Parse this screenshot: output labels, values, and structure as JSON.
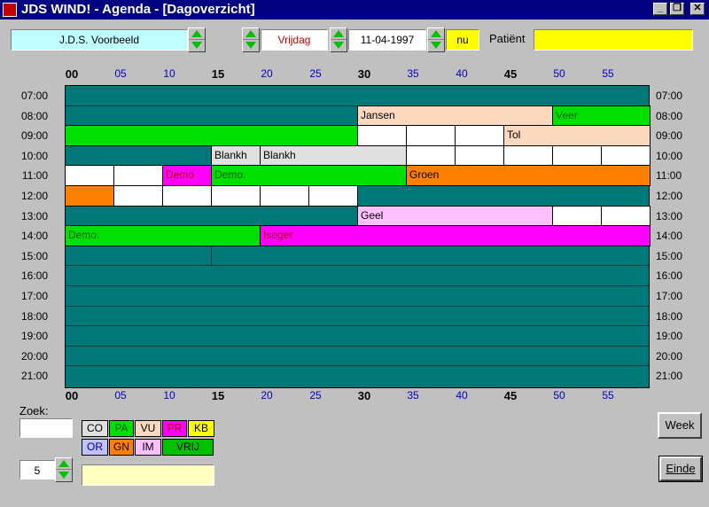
{
  "window": {
    "title": "JDS WIND! - Agenda - [Dagoverzicht]",
    "controls": {
      "minimize": "_",
      "restore": "❐",
      "close": "✕"
    }
  },
  "toolbar": {
    "practitioner": "J.D.S. Voorbeeld",
    "day": "Vrijdag",
    "date": "11-04-1997",
    "now_button": "nu",
    "patient_label": "Patiënt",
    "patient_value": ""
  },
  "grid": {
    "minutes": [
      "00",
      "05",
      "10",
      "15",
      "20",
      "25",
      "30",
      "35",
      "40",
      "45",
      "50",
      "55"
    ],
    "hours": [
      "07:00",
      "08:00",
      "09:00",
      "10:00",
      "11:00",
      "12:00",
      "13:00",
      "14:00",
      "15:00",
      "16:00",
      "17:00",
      "18:00",
      "19:00",
      "20:00",
      "21:00"
    ]
  },
  "colors": {
    "free_teal": "#007878",
    "green": "#00e000",
    "peach": "#fcd9be",
    "light_gray": "#e0e0e0",
    "magenta": "#ff00ff",
    "orange": "#ff8000",
    "pink": "#ffc0ff",
    "white": "#ffffff"
  },
  "appointments": [
    {
      "hour": 1,
      "start": 6,
      "len": 4,
      "label": "Jansen",
      "color": "#fcd9be",
      "text_color": "#000000"
    },
    {
      "hour": 1,
      "start": 10,
      "len": 2,
      "label": "Veer",
      "color": "#00e000",
      "text_color": "#006000"
    },
    {
      "hour": 2,
      "start": 0,
      "len": 6,
      "label": "",
      "color": "#00e000",
      "text_color": "#000000"
    },
    {
      "hour": 2,
      "start": 6,
      "len": 1,
      "label": "",
      "color": "#ffffff",
      "text_color": "#000000"
    },
    {
      "hour": 2,
      "start": 7,
      "len": 1,
      "label": "",
      "color": "#ffffff",
      "text_color": "#000000"
    },
    {
      "hour": 2,
      "start": 8,
      "len": 1,
      "label": "",
      "color": "#ffffff",
      "text_color": "#000000"
    },
    {
      "hour": 2,
      "start": 9,
      "len": 3,
      "label": "Tol",
      "color": "#fcd9be",
      "text_color": "#000000"
    },
    {
      "hour": 3,
      "start": 3,
      "len": 1,
      "label": "Blankh",
      "color": "#e0e0e0",
      "text_color": "#000000"
    },
    {
      "hour": 3,
      "start": 4,
      "len": 3,
      "label": "Blankh",
      "color": "#e0e0e0",
      "text_color": "#000000"
    },
    {
      "hour": 3,
      "start": 7,
      "len": 1,
      "label": "",
      "color": "#ffffff",
      "text_color": "#000000"
    },
    {
      "hour": 3,
      "start": 8,
      "len": 1,
      "label": "",
      "color": "#ffffff",
      "text_color": "#000000"
    },
    {
      "hour": 3,
      "start": 9,
      "len": 1,
      "label": "",
      "color": "#ffffff",
      "text_color": "#000000"
    },
    {
      "hour": 3,
      "start": 10,
      "len": 1,
      "label": "",
      "color": "#ffffff",
      "text_color": "#000000"
    },
    {
      "hour": 3,
      "start": 11,
      "len": 1,
      "label": "",
      "color": "#ffffff",
      "text_color": "#000000"
    },
    {
      "hour": 4,
      "start": 0,
      "len": 1,
      "label": "",
      "color": "#ffffff",
      "text_color": "#000000"
    },
    {
      "hour": 4,
      "start": 1,
      "len": 1,
      "label": "",
      "color": "#ffffff",
      "text_color": "#000000"
    },
    {
      "hour": 4,
      "start": 2,
      "len": 1,
      "label": "Demo",
      "color": "#ff00ff",
      "text_color": "#a00000"
    },
    {
      "hour": 4,
      "start": 3,
      "len": 4,
      "label": "Demo.",
      "color": "#00e000",
      "text_color": "#006000"
    },
    {
      "hour": 4,
      "start": 7,
      "len": 5,
      "label": "Groen",
      "color": "#ff8000",
      "text_color": "#000000"
    },
    {
      "hour": 5,
      "start": 0,
      "len": 1,
      "label": "",
      "color": "#ff8000",
      "text_color": "#000000"
    },
    {
      "hour": 5,
      "start": 1,
      "len": 1,
      "label": "",
      "color": "#ffffff",
      "text_color": "#000000"
    },
    {
      "hour": 5,
      "start": 2,
      "len": 1,
      "label": "",
      "color": "#ffffff",
      "text_color": "#000000"
    },
    {
      "hour": 5,
      "start": 3,
      "len": 1,
      "label": "",
      "color": "#ffffff",
      "text_color": "#000000"
    },
    {
      "hour": 5,
      "start": 4,
      "len": 1,
      "label": "",
      "color": "#ffffff",
      "text_color": "#000000"
    },
    {
      "hour": 5,
      "start": 5,
      "len": 1,
      "label": "",
      "color": "#ffffff",
      "text_color": "#000000"
    },
    {
      "hour": 6,
      "start": 6,
      "len": 4,
      "label": "Geel",
      "color": "#ffc0ff",
      "text_color": "#000000"
    },
    {
      "hour": 6,
      "start": 10,
      "len": 1,
      "label": "",
      "color": "#ffffff",
      "text_color": "#000000"
    },
    {
      "hour": 6,
      "start": 11,
      "len": 1,
      "label": "",
      "color": "#ffffff",
      "text_color": "#000000"
    },
    {
      "hour": 7,
      "start": 0,
      "len": 4,
      "label": "Demo.",
      "color": "#00e000",
      "text_color": "#006000"
    },
    {
      "hour": 7,
      "start": 4,
      "len": 8,
      "label": "Iseger",
      "color": "#ff00ff",
      "text_color": "#a00000"
    }
  ],
  "search": {
    "label": "Zoek:",
    "value": ""
  },
  "legend": [
    {
      "code": "CO",
      "color": "#e0e0e0",
      "text_color": "#000000"
    },
    {
      "code": "PA",
      "color": "#00e000",
      "text_color": "#006000"
    },
    {
      "code": "VU",
      "color": "#fcd9be",
      "text_color": "#000000"
    },
    {
      "code": "PR",
      "color": "#ff00ff",
      "text_color": "#a00000"
    },
    {
      "code": "KB",
      "color": "#ffff00",
      "text_color": "#000000"
    },
    {
      "code": "OR",
      "color": "#c0c0ff",
      "text_color": "#000080"
    },
    {
      "code": "GN",
      "color": "#ff8000",
      "text_color": "#000000"
    },
    {
      "code": "IM",
      "color": "#ffc0ff",
      "text_color": "#000000"
    },
    {
      "code": "VRIJ",
      "color": "#00c000",
      "text_color": "#000000"
    }
  ],
  "interval": {
    "value": "5"
  },
  "note": {
    "value": ""
  },
  "buttons": {
    "week": "Week",
    "exit": "Einde"
  }
}
